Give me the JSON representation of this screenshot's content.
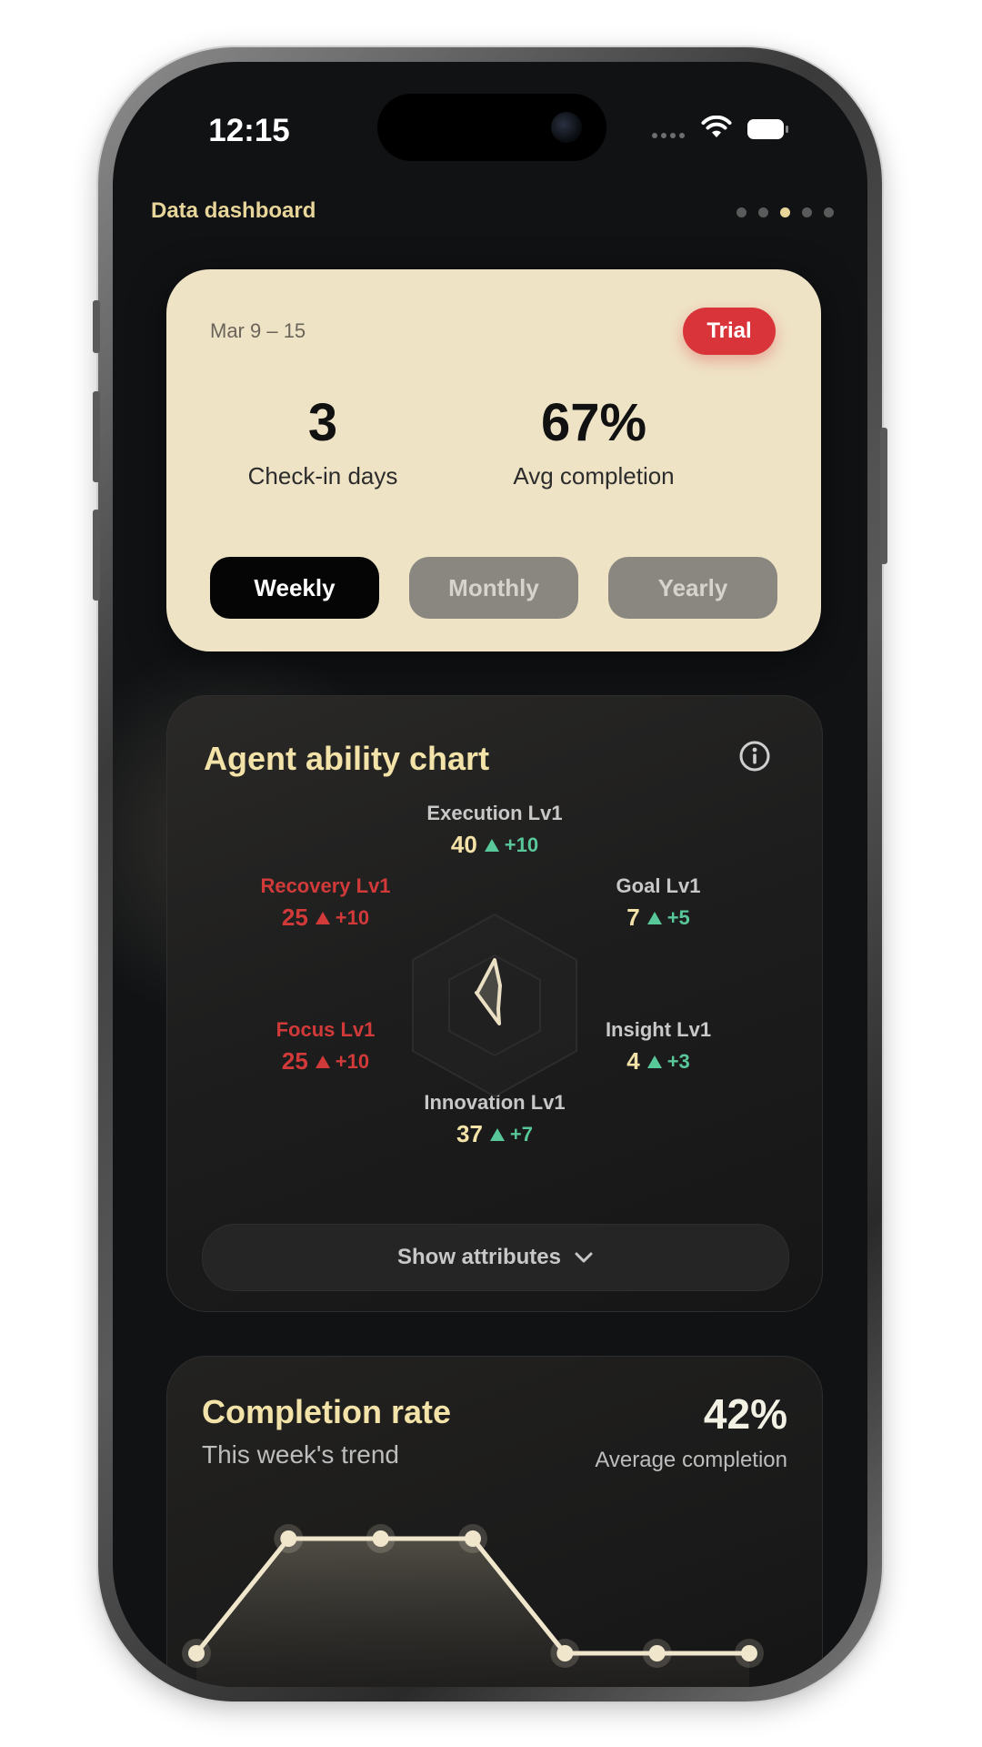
{
  "status_bar": {
    "time": "12:15"
  },
  "header": {
    "title": "Data dashboard",
    "page_indicator": {
      "count": 5,
      "active_index": 2
    }
  },
  "summary": {
    "date_range": "Mar 9 – 15",
    "badge": "Trial",
    "stats": [
      {
        "value": "3",
        "label": "Check-in days"
      },
      {
        "value": "67%",
        "label": "Avg completion"
      }
    ],
    "periods": [
      {
        "label": "Weekly",
        "active": true
      },
      {
        "label": "Monthly",
        "active": false
      },
      {
        "label": "Yearly",
        "active": false
      }
    ]
  },
  "ability": {
    "title": "Agent ability chart",
    "attributes": [
      {
        "name": "Execution Lv1",
        "value": "40",
        "delta": "+10"
      },
      {
        "name": "Goal Lv1",
        "value": "7",
        "delta": "+5"
      },
      {
        "name": "Insight Lv1",
        "value": "4",
        "delta": "+3"
      },
      {
        "name": "Innovation Lv1",
        "value": "37",
        "delta": "+7"
      },
      {
        "name": "Focus Lv1",
        "value": "25",
        "delta": "+10"
      },
      {
        "name": "Recovery Lv1",
        "value": "25",
        "delta": "+10"
      }
    ],
    "show_button": "Show attributes"
  },
  "completion": {
    "title": "Completion rate",
    "subtitle": "This week's trend",
    "avg_value": "42%",
    "avg_label": "Average completion",
    "trend": [
      0,
      1,
      1,
      1,
      0,
      0,
      0
    ]
  },
  "colors": {
    "accent": "#f3e3a8",
    "card_light": "#efe3c6",
    "badge_red": "#d8343a",
    "positive_green": "#58c79a",
    "warning_red": "#d23a3a"
  }
}
